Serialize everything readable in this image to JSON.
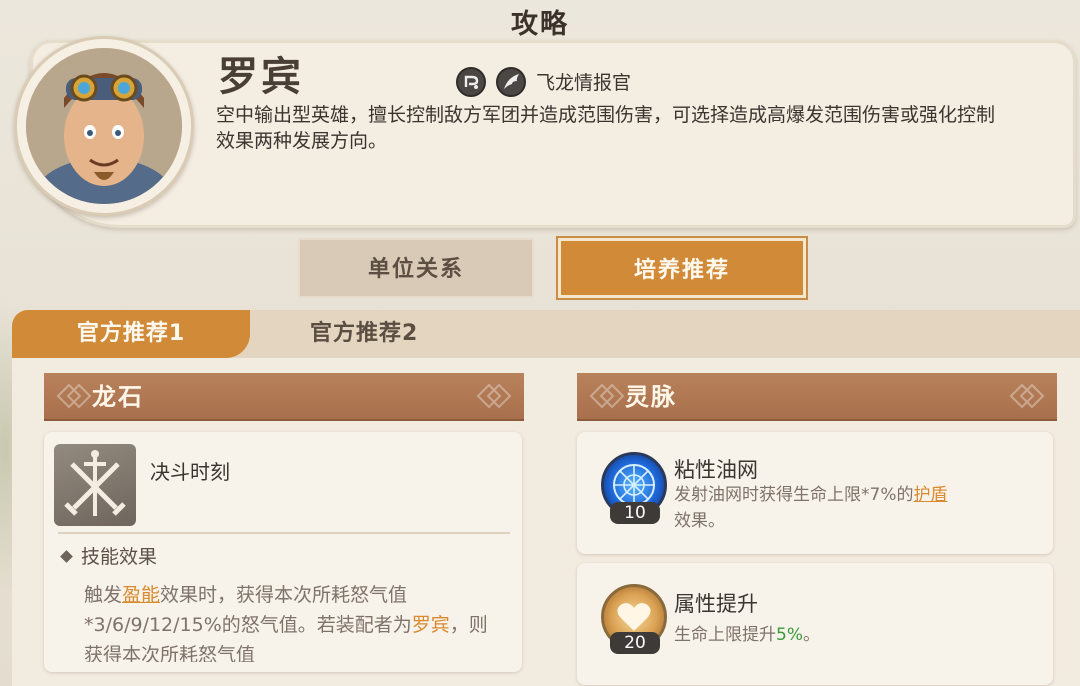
{
  "header": {
    "title": "攻略"
  },
  "hero": {
    "name": "罗宾",
    "class": "飞龙情报官",
    "description": "空中输出型英雄，擅长控制敌方军团并造成范围伤害，可选择造成高爆发范围伤害或强化控制效果两种发展方向。"
  },
  "main_tabs": [
    {
      "label": "单位关系",
      "active": false
    },
    {
      "label": "培养推荐",
      "active": true
    }
  ],
  "sub_tabs": [
    {
      "label": "官方推荐1",
      "active": true
    },
    {
      "label": "官方推荐2",
      "active": false
    }
  ],
  "dragon_stone": {
    "header": "龙石",
    "skill_name": "决斗时刻",
    "effect_title": "技能效果",
    "effect_text_1": "触发",
    "effect_link": "盈能",
    "effect_text_2": "效果时，获得本次所耗怒气值*3/6/9/12/15%的怒气值。若装配者为",
    "effect_hero": "罗宾",
    "effect_text_3": "，则获得本次所耗怒气值"
  },
  "spirit": {
    "header": "灵脉",
    "items": [
      {
        "name": "粘性油网",
        "level": "10",
        "desc_1": "发射油网时获得生命上限*7%的",
        "desc_link": "护盾",
        "desc_2": "效果。"
      },
      {
        "name": "属性提升",
        "level": "20",
        "desc_1": "生命上限提升",
        "desc_value": "5%",
        "desc_2": "。"
      }
    ]
  },
  "colors": {
    "accent": "#d08a38",
    "section_header": "#b07852",
    "highlight": "#d9892e",
    "green": "#3a9a3a"
  }
}
